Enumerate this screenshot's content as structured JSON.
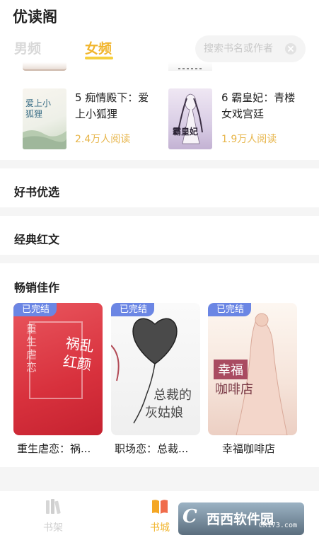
{
  "app": {
    "title": "优读阁"
  },
  "tabs": [
    {
      "label": "男频",
      "active": false
    },
    {
      "label": "女频",
      "active": true
    }
  ],
  "search": {
    "placeholder": "搜索书名或作者",
    "icon": "close-icon"
  },
  "top_books": [
    {
      "title": "5 痴情殿下：爱上小狐狸",
      "reads": "2.4万人阅读",
      "cover_text": "爱上小狐狸"
    },
    {
      "title": "6 霸皇妃：青楼女戏宫廷",
      "reads": "1.9万人阅读",
      "cover_text": "霸皇妃"
    }
  ],
  "sections": [
    {
      "title": "好书优选"
    },
    {
      "title": "经典红文"
    },
    {
      "title": "畅销佳作"
    }
  ],
  "bestsellers": [
    {
      "badge": "已完结",
      "title": "重生虐恋：祸...",
      "cover_text_a": "重生虐恋",
      "cover_text_b": "祸乱红颜"
    },
    {
      "badge": "已完结",
      "title": "职场恋：总裁...",
      "cover_text_a": "总裁的",
      "cover_text_b": "灰姑娘"
    },
    {
      "badge": "已完结",
      "title": "幸福咖啡店",
      "cover_text_a": "幸福",
      "cover_text_b": "咖啡店"
    }
  ],
  "bottom_nav": [
    {
      "label": "书架",
      "icon": "bookshelf-icon",
      "active": false
    },
    {
      "label": "书城",
      "icon": "open-book-icon",
      "active": true
    }
  ],
  "watermark": {
    "brand": "西西软件园",
    "url": "CR173.com"
  },
  "colors": {
    "accent": "#f1b52d",
    "badge": "#6b86e4",
    "reads": "#e7b54a"
  }
}
